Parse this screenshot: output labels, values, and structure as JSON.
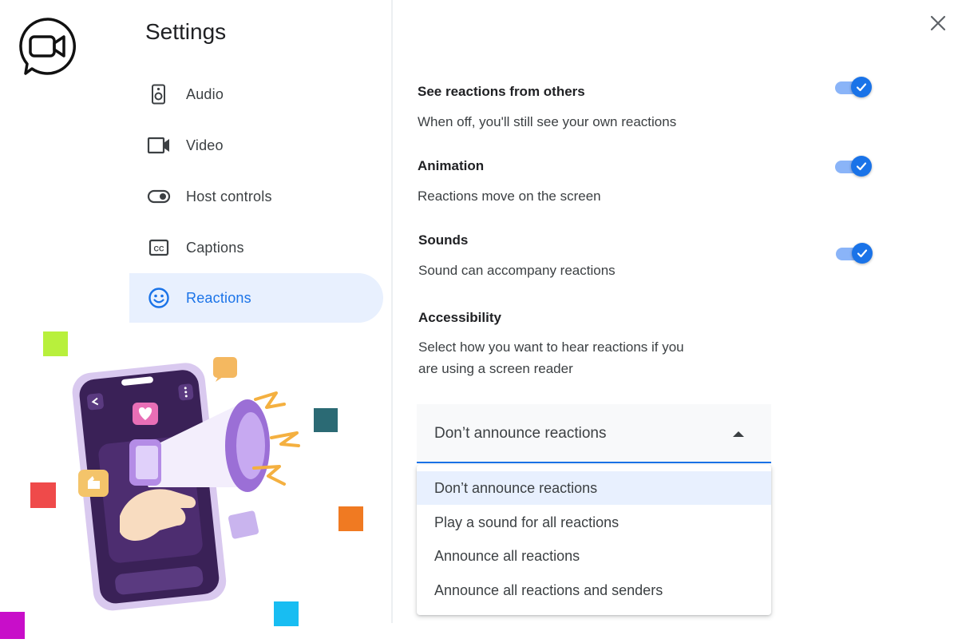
{
  "app": {
    "logo": "video-chat-logo-icon"
  },
  "sidebar": {
    "title": "Settings",
    "items": [
      {
        "label": "Audio",
        "icon": "speaker-icon"
      },
      {
        "label": "Video",
        "icon": "video-camera-icon"
      },
      {
        "label": "Host controls",
        "icon": "toggle-icon"
      },
      {
        "label": "Captions",
        "icon": "closed-captions-icon"
      },
      {
        "label": "Reactions",
        "icon": "smiley-icon",
        "active": true
      }
    ]
  },
  "settings": {
    "see_reactions": {
      "title": "See reactions from others",
      "description": "When off, you'll still see your own reactions",
      "enabled": true
    },
    "animation": {
      "title": "Animation",
      "description": "Reactions move on the screen",
      "enabled": true
    },
    "sounds": {
      "title": "Sounds",
      "description": "Sound can accompany reactions",
      "enabled": true
    },
    "accessibility": {
      "title": "Accessibility",
      "description_line1": "Select how you want to hear reactions if you",
      "description_line2": "are using a screen reader",
      "selected": "Don’t announce reactions",
      "options": [
        "Don’t announce reactions",
        "Play a sound for all reactions",
        "Announce all reactions",
        "Announce all reactions and senders"
      ]
    }
  },
  "colors": {
    "accent": "#1a73e8",
    "active_bg": "#e8f0fe",
    "toggle_track": "#8ab4f8"
  }
}
